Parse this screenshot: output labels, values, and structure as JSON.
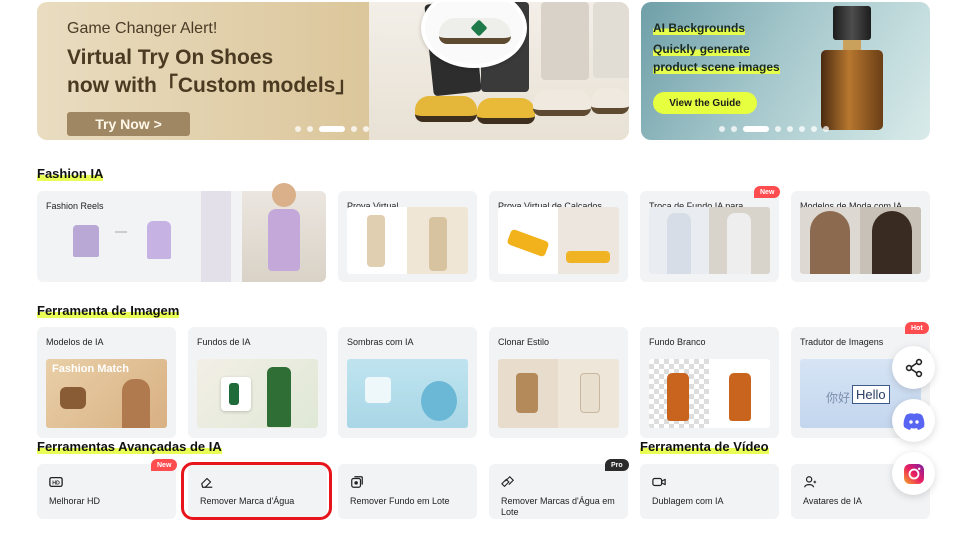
{
  "banner_main": {
    "alert": "Game Changer Alert!",
    "title_line1": "Virtual Try On Shoes",
    "title_line2": "now with「Custom models」",
    "cta": "Try Now >"
  },
  "banner_side": {
    "line1": "AI Backgrounds",
    "line2": "Quickly generate",
    "line3": "product scene images",
    "cta": "View the Guide"
  },
  "sections": {
    "fashion": "Fashion IA",
    "image_tools": "Ferramenta de Imagem",
    "advanced": "Ferramentas Avançadas de IA",
    "video": "Ferramenta de Vídeo"
  },
  "fashion_cards": [
    {
      "label": "Fashion Reels"
    },
    {
      "label": "Prova Virtual"
    },
    {
      "label": "Prova Virtual de Calçados"
    },
    {
      "label": "Troca de Fundo IA para Modelos",
      "badge": "New"
    },
    {
      "label": "Modelos de Moda com IA"
    }
  ],
  "image_cards": [
    {
      "label": "Modelos de IA",
      "thumb_text": "Fashion Match"
    },
    {
      "label": "Fundos de IA"
    },
    {
      "label": "Sombras com IA"
    },
    {
      "label": "Clonar Estilo"
    },
    {
      "label": "Fundo Branco"
    },
    {
      "label": "Tradutor de Imagens",
      "badge": "Hot",
      "thumb_text_a": "你好",
      "thumb_text_b": "Hello"
    }
  ],
  "tools": [
    {
      "label": "Melhorar HD",
      "badge": "New",
      "icon": "hd-icon"
    },
    {
      "label": "Remover Marca d'Água",
      "icon": "eraser-icon"
    },
    {
      "label": "Remover Fundo em Lote",
      "icon": "batch-remove-icon"
    },
    {
      "label": "Remover Marcas d'Água em Lote",
      "badge": "Pro",
      "icon": "batch-eraser-icon"
    },
    {
      "label": "Dublagem com IA",
      "icon": "video-camera-icon"
    },
    {
      "label": "Avatares de IA",
      "icon": "avatar-icon"
    }
  ],
  "colors": {
    "accent_highlight": "#e9ff56",
    "badge_red": "#ff4d4f",
    "selection_border": "#e8141b",
    "card_bg": "#f2f3f5"
  }
}
